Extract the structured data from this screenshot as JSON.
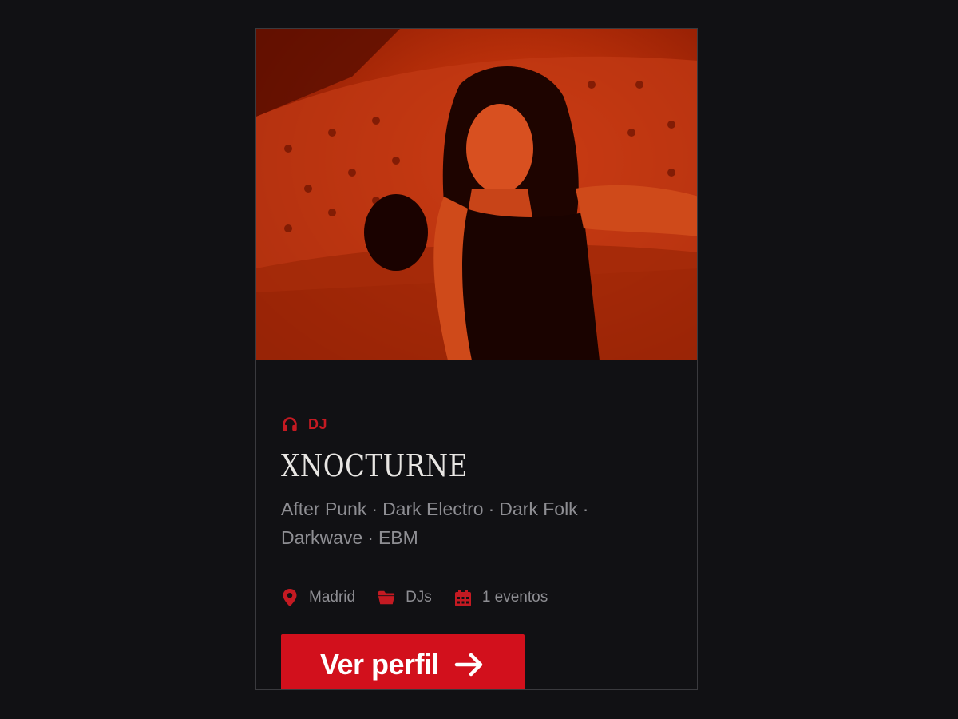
{
  "colors": {
    "page_background": "#111114",
    "card_border": "#3a3a3e",
    "accent_red": "#d2101c",
    "category_red": "#c41a22",
    "title": "#e8e6e3",
    "muted_text": "#8e8e93",
    "photo_tint": "#b32000"
  },
  "card": {
    "photo": {
      "icon": "artist-photo"
    },
    "category": {
      "icon": "headphones-icon",
      "label": "DJ"
    },
    "title": "XNOCTURNE",
    "genres": [
      "After Punk",
      "Dark Electro",
      "Dark Folk",
      "Darkwave",
      "EBM"
    ],
    "meta": {
      "location": {
        "icon": "map-pin-icon",
        "label": "Madrid"
      },
      "category": {
        "icon": "folder-icon",
        "label": "DJs"
      },
      "events": {
        "icon": "calendar-icon",
        "label": "1 eventos"
      }
    },
    "button": {
      "label": "Ver perfil",
      "icon": "arrow-right-icon"
    }
  }
}
